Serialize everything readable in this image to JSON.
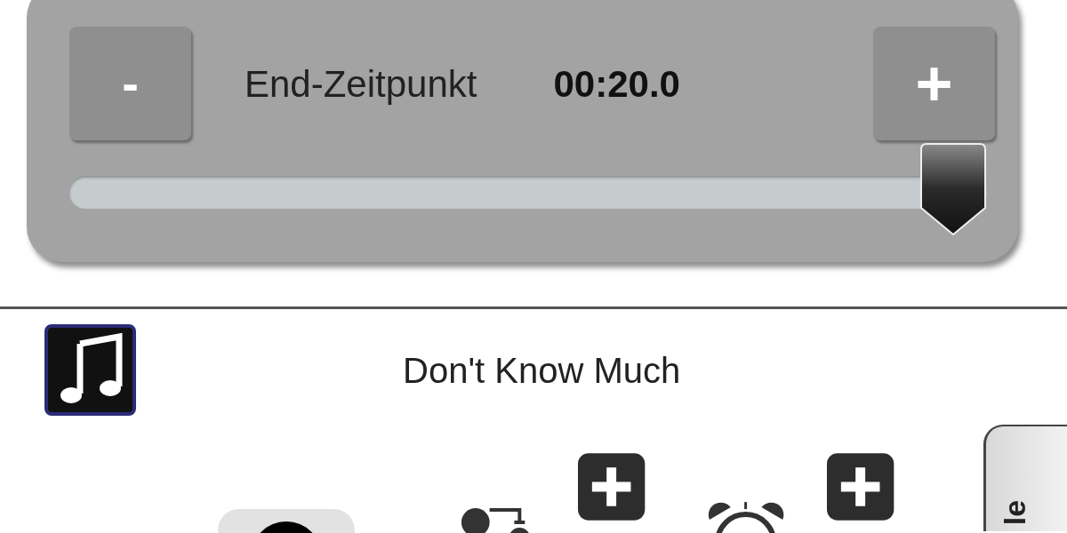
{
  "slider_panel": {
    "minus_label": "-",
    "label": "End-Zeitpunkt",
    "value": "00:20.0",
    "plus_label": "+",
    "level": 1.0
  },
  "now_playing": {
    "title": "Don't Know Much"
  },
  "side_tab": {
    "label": "le"
  }
}
